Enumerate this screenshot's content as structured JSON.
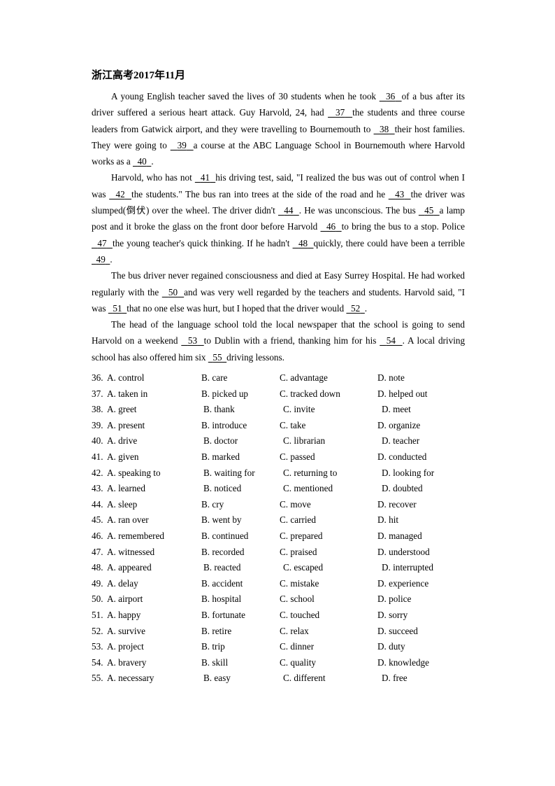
{
  "document": {
    "title": "浙江高考2017年11月"
  },
  "passage": {
    "paragraphs": [
      [
        {
          "t": "text",
          "v": "A young English teacher saved the lives of 30 students when he took "
        },
        {
          "t": "blank",
          "v": "36"
        },
        {
          "t": "text",
          "v": "of a bus after its driver suffered a serious heart attack. Guy Harvold, 24, had "
        },
        {
          "t": "blank",
          "v": "37"
        },
        {
          "t": "text",
          "v": "the students and three course leaders from Gatwick airport, and they were travelling to Bournemouth to "
        },
        {
          "t": "blank",
          "v": "38"
        },
        {
          "t": "text",
          "v": "their host families. They were going to "
        },
        {
          "t": "blank",
          "v": "39"
        },
        {
          "t": "text",
          "v": "a course at the ABC Language School in Bournemouth where Harvold works as a "
        },
        {
          "t": "blank",
          "v": "40"
        },
        {
          "t": "text",
          "v": "."
        }
      ],
      [
        {
          "t": "text",
          "v": "Harvold, who has not "
        },
        {
          "t": "blank",
          "v": "41"
        },
        {
          "t": "text",
          "v": "his driving test, said, \"I realized the bus was out of control when I was "
        },
        {
          "t": "blank",
          "v": "42"
        },
        {
          "t": "text",
          "v": "the students.\" The bus ran into trees at the side of the road and he "
        },
        {
          "t": "blank",
          "v": "43"
        },
        {
          "t": "text",
          "v": "the driver was slumped(倒伏) over the wheel. The driver didn't "
        },
        {
          "t": "blank",
          "v": "44"
        },
        {
          "t": "text",
          "v": ". He was unconscious. The bus "
        },
        {
          "t": "blank",
          "v": "45"
        },
        {
          "t": "text",
          "v": "a lamp post and it broke the glass on the front door before Harvold "
        },
        {
          "t": "blank",
          "v": "46"
        },
        {
          "t": "text",
          "v": "to bring the bus to a stop. Police "
        },
        {
          "t": "blank",
          "v": "47"
        },
        {
          "t": "text",
          "v": "the young teacher's quick thinking. If he hadn't "
        },
        {
          "t": "blank",
          "v": "48"
        },
        {
          "t": "text",
          "v": "quickly, there could have been a terrible "
        },
        {
          "t": "blank",
          "v": "49"
        },
        {
          "t": "text",
          "v": "."
        }
      ],
      [
        {
          "t": "text",
          "v": "The bus driver never regained consciousness and died at Easy Surrey Hospital. He had worked regularly with the "
        },
        {
          "t": "blank",
          "v": "50"
        },
        {
          "t": "text",
          "v": "and was very well regarded by the teachers and students. Harvold said, \"I was "
        },
        {
          "t": "blank",
          "v": "51"
        },
        {
          "t": "text",
          "v": "that no one else was hurt, but I hoped that the driver would "
        },
        {
          "t": "blank",
          "v": "52"
        },
        {
          "t": "text",
          "v": "."
        }
      ],
      [
        {
          "t": "text",
          "v": "The head of the language school told the local newspaper that the school is going to send Harvold on a weekend "
        },
        {
          "t": "blank",
          "v": "53"
        },
        {
          "t": "text",
          "v": "to Dublin with a friend, thanking him for his "
        },
        {
          "t": "blank",
          "v": "54"
        },
        {
          "t": "text",
          "v": ". A local driving school has also offered him six "
        },
        {
          "t": "blank",
          "v": "55"
        },
        {
          "t": "text",
          "v": "driving lessons."
        }
      ]
    ]
  },
  "questions": [
    {
      "num": "36.",
      "a": "A. control",
      "b": "B. care",
      "c": "C. advantage",
      "d": "D. note",
      "jitter": false
    },
    {
      "num": "37.",
      "a": "A. taken in",
      "b": "B. picked up",
      "c": "C. tracked down",
      "d": "D. helped out",
      "jitter": false
    },
    {
      "num": "38.",
      "a": "A. greet",
      "b": "B. thank",
      "c": "C. invite",
      "d": "D. meet",
      "jitter": true
    },
    {
      "num": "39.",
      "a": "A. present",
      "b": "B. introduce",
      "c": "C. take",
      "d": "D. organize",
      "jitter": false
    },
    {
      "num": "40.",
      "a": "A. drive",
      "b": "B. doctor",
      "c": "C. librarian",
      "d": "D. teacher",
      "jitter": true
    },
    {
      "num": "41.",
      "a": "A. given",
      "b": "B. marked",
      "c": "C. passed",
      "d": "D. conducted",
      "jitter": false
    },
    {
      "num": "42.",
      "a": "A. speaking to",
      "b": "B. waiting for",
      "c": "C. returning to",
      "d": "D. looking for",
      "jitter": true
    },
    {
      "num": "43.",
      "a": "A. learned",
      "b": "B. noticed",
      "c": "C. mentioned",
      "d": "D. doubted",
      "jitter": true
    },
    {
      "num": "44.",
      "a": "A. sleep",
      "b": "B. cry",
      "c": "C. move",
      "d": "D. recover",
      "jitter": false
    },
    {
      "num": "45.",
      "a": "A. ran over",
      "b": "B. went by",
      "c": "C. carried",
      "d": "D. hit",
      "jitter": false
    },
    {
      "num": "46.",
      "a": "A. remembered",
      "b": "B. continued",
      "c": "C. prepared",
      "d": "D. managed",
      "jitter": false
    },
    {
      "num": "47.",
      "a": "A. witnessed",
      "b": "B. recorded",
      "c": "C. praised",
      "d": "D. understood",
      "jitter": false
    },
    {
      "num": "48.",
      "a": "A. appeared",
      "b": "B. reacted",
      "c": "C. escaped",
      "d": "D. interrupted",
      "jitter": true
    },
    {
      "num": "49.",
      "a": "A. delay",
      "b": "B. accident",
      "c": "C. mistake",
      "d": "D. experience",
      "jitter": false
    },
    {
      "num": "50.",
      "a": "A. airport",
      "b": "B. hospital",
      "c": "C. school",
      "d": "D. police",
      "jitter": false
    },
    {
      "num": "51.",
      "a": "A. happy",
      "b": "B. fortunate",
      "c": "C. touched",
      "d": "D. sorry",
      "jitter": false
    },
    {
      "num": "52.",
      "a": "A. survive",
      "b": "B. retire",
      "c": "C. relax",
      "d": "D. succeed",
      "jitter": false
    },
    {
      "num": "53.",
      "a": "A. project",
      "b": "B. trip",
      "c": "C. dinner",
      "d": "D. duty",
      "jitter": false
    },
    {
      "num": "54.",
      "a": "A. bravery",
      "b": "B. skill",
      "c": "C. quality",
      "d": "D. knowledge",
      "jitter": false
    },
    {
      "num": "55.",
      "a": "A. necessary",
      "b": "B. easy",
      "c": "C. different",
      "d": "D. free",
      "jitter": true
    }
  ]
}
